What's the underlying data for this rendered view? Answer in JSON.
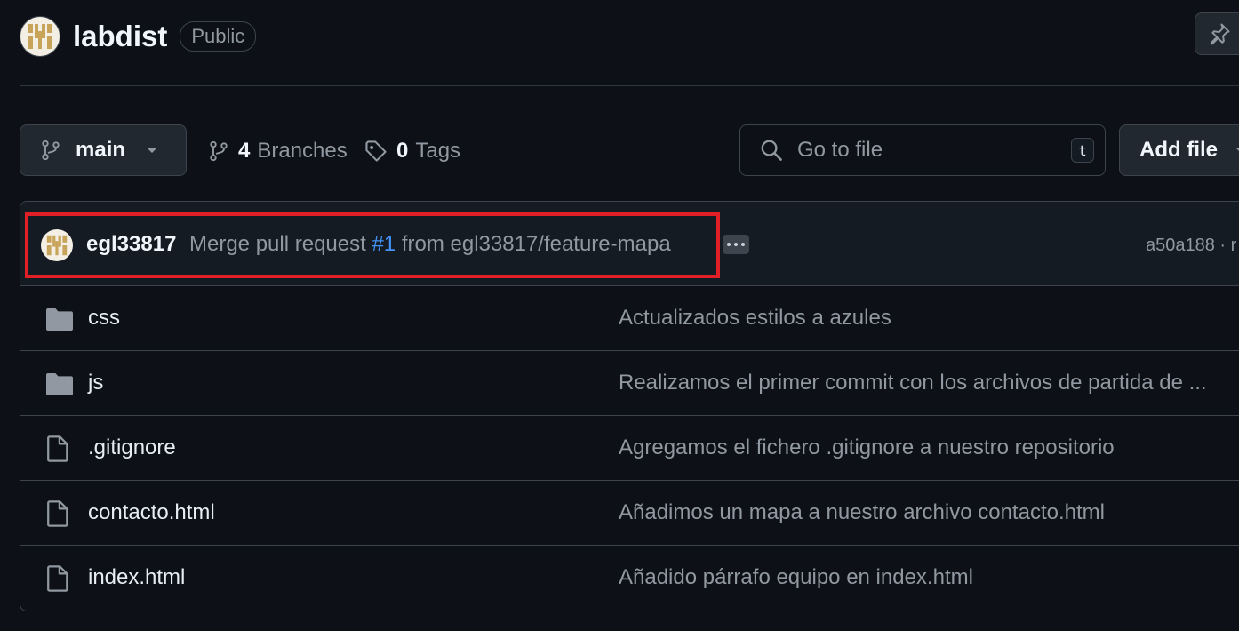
{
  "repo": {
    "name": "labdist",
    "visibility": "Public"
  },
  "toolbar": {
    "branch": "main",
    "branches_count": "4",
    "branches_label": "Branches",
    "tags_count": "0",
    "tags_label": "Tags",
    "search_placeholder": "Go to file",
    "search_shortcut": "t",
    "add_file_label": "Add file"
  },
  "latest_commit": {
    "author": "egl33817",
    "message_prefix": "Merge pull request",
    "pr_link": "#1",
    "message_suffix": "from egl33817/feature-mapa",
    "sha": "a50a188 · r"
  },
  "files": [
    {
      "name": "css",
      "type": "folder",
      "commit": "Actualizados estilos a azules"
    },
    {
      "name": "js",
      "type": "folder",
      "commit": "Realizamos el primer commit con los archivos de partida de ..."
    },
    {
      "name": ".gitignore",
      "type": "file",
      "commit": "Agregamos el fichero .gitignore a nuestro repositorio"
    },
    {
      "name": "contacto.html",
      "type": "file",
      "commit": "Añadimos un mapa a nuestro archivo contacto.html"
    },
    {
      "name": "index.html",
      "type": "file",
      "commit": "Añadido párrafo equipo en index.html"
    }
  ],
  "colors": {
    "background": "#0d1117",
    "border": "#3d444d",
    "link": "#4493f8",
    "highlight": "#e01f26",
    "avatar_gold": "#c8a45a"
  },
  "icons": {
    "folder": "folder-icon",
    "file": "file-icon",
    "branch": "git-branch-icon",
    "tag": "tag-icon",
    "search": "search-icon",
    "pin": "pin-icon"
  }
}
